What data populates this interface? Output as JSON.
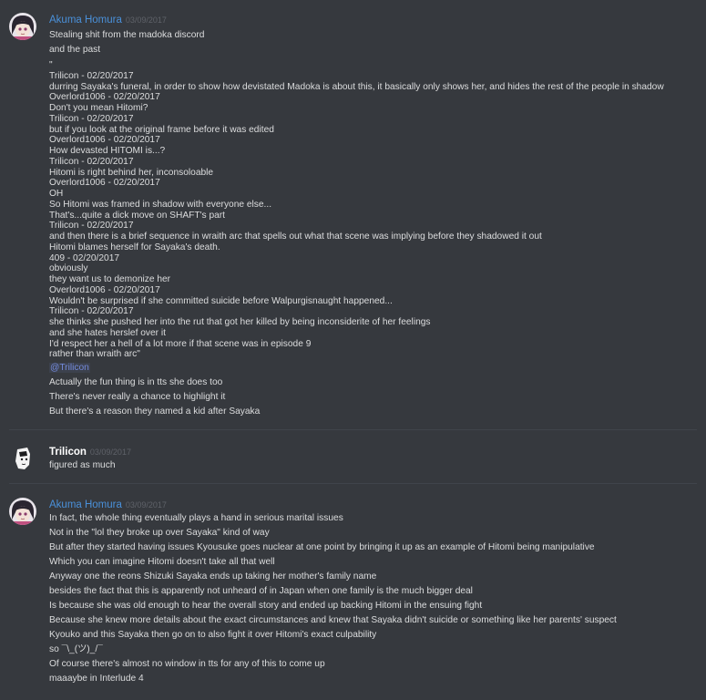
{
  "messages": [
    {
      "username": "Akuma Homura",
      "timestamp": "03/09/2017",
      "intro": [
        "Stealing shit from the madoka discord",
        "and the past"
      ],
      "quote": [
        "\"",
        "Trilicon - 02/20/2017",
        "durring Sayaka's funeral, in order to show how devistated Madoka is about this, it basically only shows her, and hides the rest of the people in shadow",
        "Overlord1006 - 02/20/2017",
        "Don't you mean Hitomi?",
        "Trilicon - 02/20/2017",
        "but if you look at the original  frame before it was edited",
        "Overlord1006 - 02/20/2017",
        "How devasted HITOMI is...?",
        "Trilicon - 02/20/2017",
        "Hitomi is right behind her, inconsoloable",
        "Overlord1006 - 02/20/2017",
        "OH",
        "So Hitomi was framed in shadow with everyone else...",
        "That's...quite a dick move on SHAFT's part",
        "Trilicon - 02/20/2017",
        "and then there is a brief sequence in wraith arc that spells out what that scene was implying before they shadowed it out",
        "Hitomi blames herself for Sayaka's death.",
        "409 - 02/20/2017",
        "obviously",
        "they want us to demonize her",
        "Overlord1006 - 02/20/2017",
        "Wouldn't be surprised if she committed suicide before Walpurgisnaught happened...",
        "Trilicon - 02/20/2017",
        "she thinks she pushed her into the rut that got her killed by being inconsiderite of her feelings",
        "and she hates herslef over it",
        "I'd respect her a hell of a lot more if that scene was in episode 9",
        "rather than wraith arc\""
      ],
      "mention": "@Trilicon",
      "outro": [
        "Actually the fun thing is in tts she does too",
        "There's never really a chance to highlight it",
        "But there's a reason they named a kid after Sayaka"
      ]
    },
    {
      "username": "Trilicon",
      "timestamp": "03/09/2017",
      "lines": [
        "figured as much"
      ]
    },
    {
      "username": "Akuma Homura",
      "timestamp": "03/09/2017",
      "lines": [
        "In fact, the whole thing eventually plays a hand in serious marital issues",
        "Not in the \"lol they broke up over Sayaka\" kind of way",
        "But after they started having issues Kyousuke goes nuclear at one point by bringing it up as an example of Hitomi being manipulative",
        "Which you can imagine Hitomi doesn't take all that well",
        "Anyway one the reons Shizuki Sayaka ends up taking her mother's family name",
        "besides the fact that this is apparently not unheard of in Japan when one family is the much bigger deal",
        "Is because she was old enough to hear the overall story and ended up backing Hitomi in the ensuing fight",
        "Because she knew more details about the exact circumstances and knew that Sayaka didn't suicide or something like her parents' suspect",
        "Kyouko and this Sayaka then go on to also fight it over Hitomi's exact culpability",
        "so ¯\\_(ツ)_/¯",
        "Of course there's almost no window in tts for any of this to come up",
        "maaaybe in Interlude 4"
      ]
    }
  ],
  "colors": {
    "background": "#36393e",
    "text": "#dcddde",
    "username_blue": "#4a90d9",
    "username_white": "#ffffff",
    "timestamp": "#5f6269",
    "mention": "#7289da"
  }
}
